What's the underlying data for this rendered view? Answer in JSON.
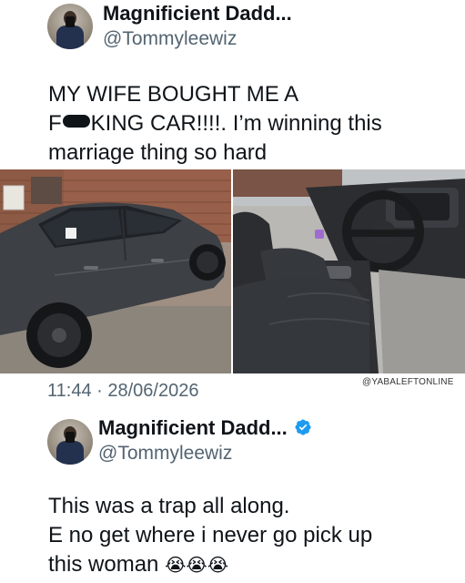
{
  "tweet1": {
    "display_name": "Magnificient Dadd...",
    "handle": "@Tommyleewiz",
    "text_line1": "MY WIFE BOUGHT ME A",
    "text_line2_prefix": "F",
    "text_line2_suffix": "KING CAR!!!!. I’m winning this",
    "text_line3": "marriage thing so hard",
    "timestamp": "11:44 · 28/06/2026",
    "watermark": "@YABALEFTONLINE",
    "media": [
      {
        "description": "grey-sedan-exterior"
      },
      {
        "description": "car-interior-seats-steering"
      }
    ]
  },
  "tweet2": {
    "display_name": "Magnificient Dadd...",
    "handle": "@Tommyleewiz",
    "verified": true,
    "text_line1": "This was a trap all along.",
    "text_line2": "E no get where i never go pick up",
    "text_line3": "this woman",
    "emojis": "😭😭😭"
  },
  "colors": {
    "text": "#0f1419",
    "secondary": "#536471",
    "verified_blue": "#1d9bf0"
  }
}
